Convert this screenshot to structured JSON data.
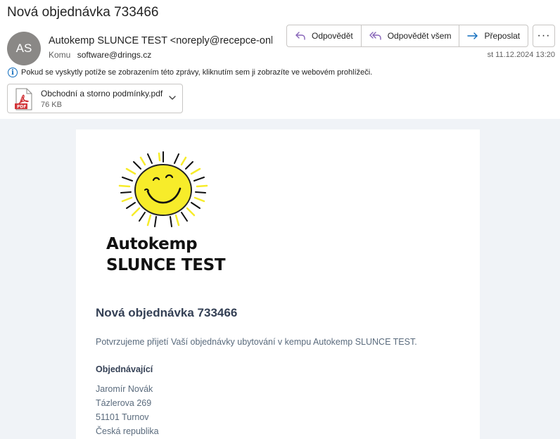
{
  "email": {
    "subject": "Nová objednávka 733466",
    "avatar_initials": "AS",
    "sender": "Autokemp SLUNCE TEST <noreply@recepce-online.cz>",
    "to_label": "Komu",
    "to_address": "software@drings.cz",
    "date": "st 11.12.2024 13:20",
    "info_text": "Pokud se vyskytly potíže se zobrazením této zprávy, kliknutím sem ji zobrazíte ve webovém prohlížeči."
  },
  "actions": {
    "reply": "Odpovědět",
    "reply_all": "Odpovědět všem",
    "forward": "Přeposlat",
    "more": "···"
  },
  "attachment": {
    "name": "Obchodní a storno podmínky.pdf",
    "size": "76 KB",
    "type_label": "PDF"
  },
  "message": {
    "brand_line1": "Autokemp",
    "brand_line2": "SLUNCE TEST",
    "title": "Nová objednávka 733466",
    "confirmation": "Potvrzujeme přijetí Vaší objednávky ubytování v kempu Autokemp SLUNCE TEST.",
    "orderer_heading": "Objednávající",
    "orderer": {
      "name": "Jaromír Novák",
      "street": "Tázlerova 269",
      "city": "51101 Turnov",
      "country": "Česká republika"
    }
  },
  "colors": {
    "accent_reply": "#8764b8",
    "accent_forward": "#0f6cbd",
    "pdf_red": "#d13438",
    "heading": "#344055",
    "body_text": "#5a6b7d",
    "sun_yellow": "#f7ec2a"
  }
}
